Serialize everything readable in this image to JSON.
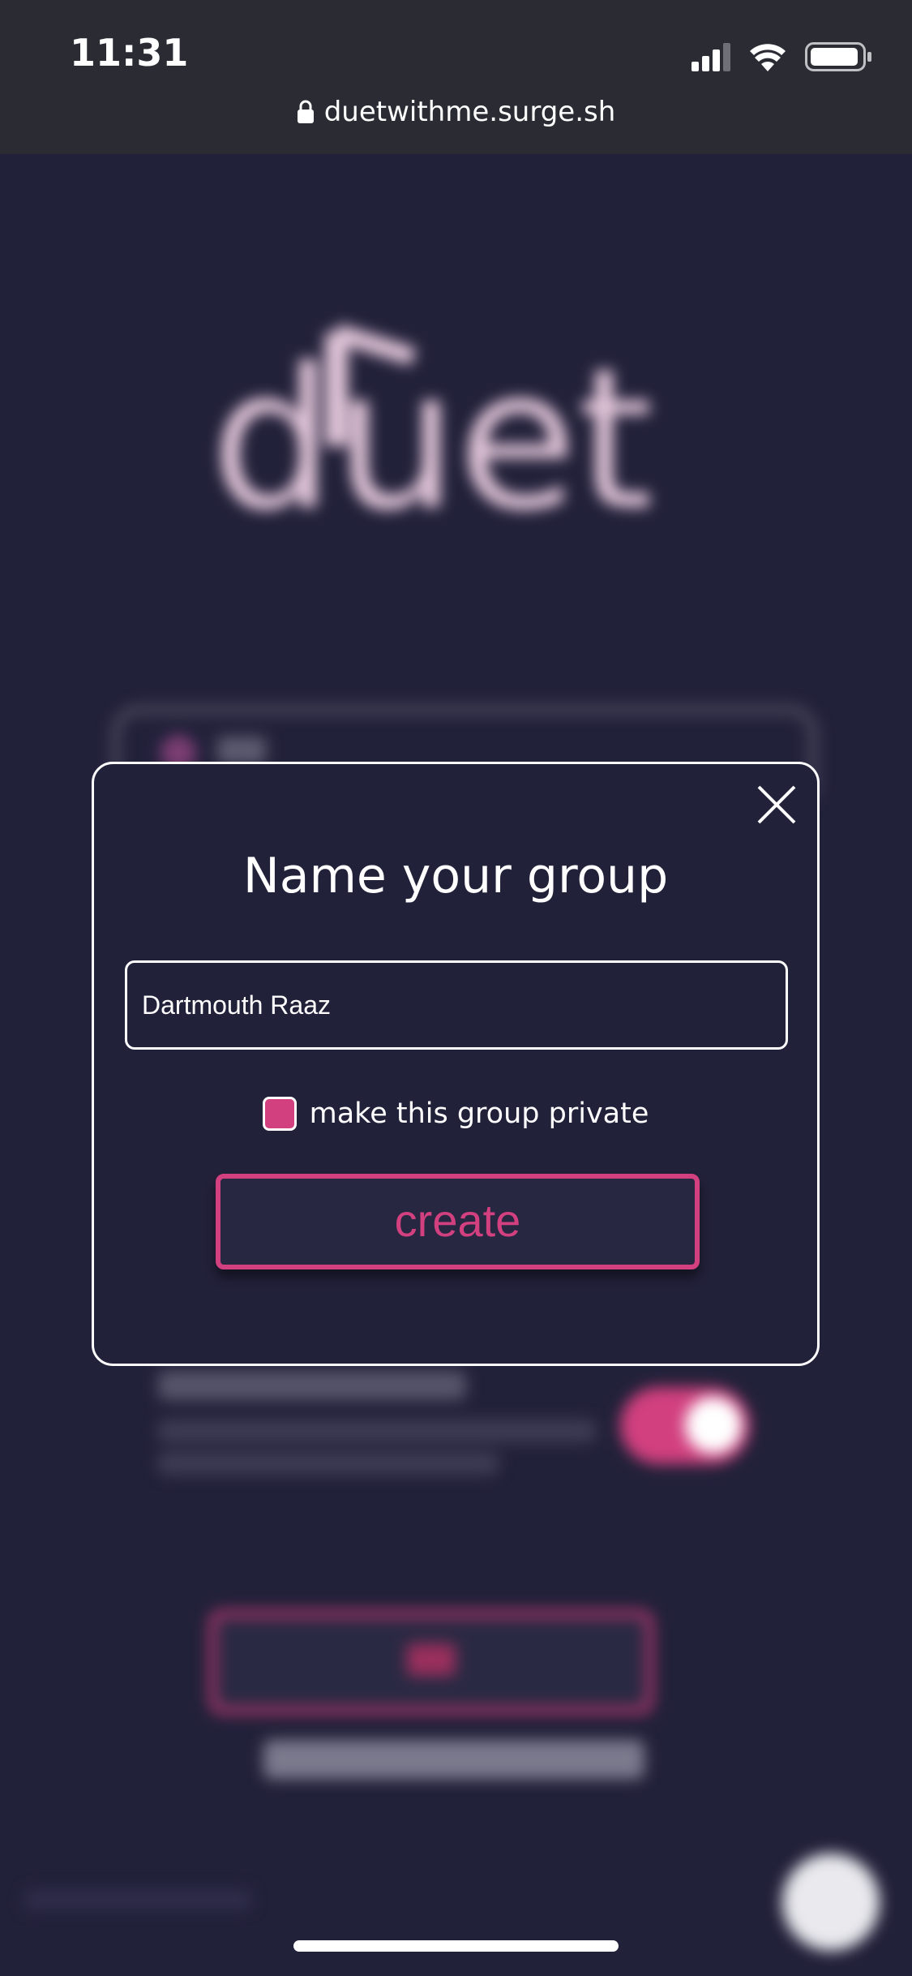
{
  "status_bar": {
    "time": "11:31",
    "icons": [
      "cellular-signal-icon",
      "wifi-icon",
      "battery-icon"
    ]
  },
  "browser": {
    "url": "duetwithme.surge.sh"
  },
  "background": {
    "logo_text": "duet"
  },
  "modal": {
    "title": "Name your group",
    "group_name_value": "Dartmouth Raaz",
    "private_label": "make this group private",
    "private_checked": true,
    "create_label": "create",
    "close_icon": "close-icon"
  },
  "colors": {
    "background": "#22213a",
    "accent": "#d2407f",
    "status_bar": "#2b2b34",
    "text": "#ffffff"
  }
}
